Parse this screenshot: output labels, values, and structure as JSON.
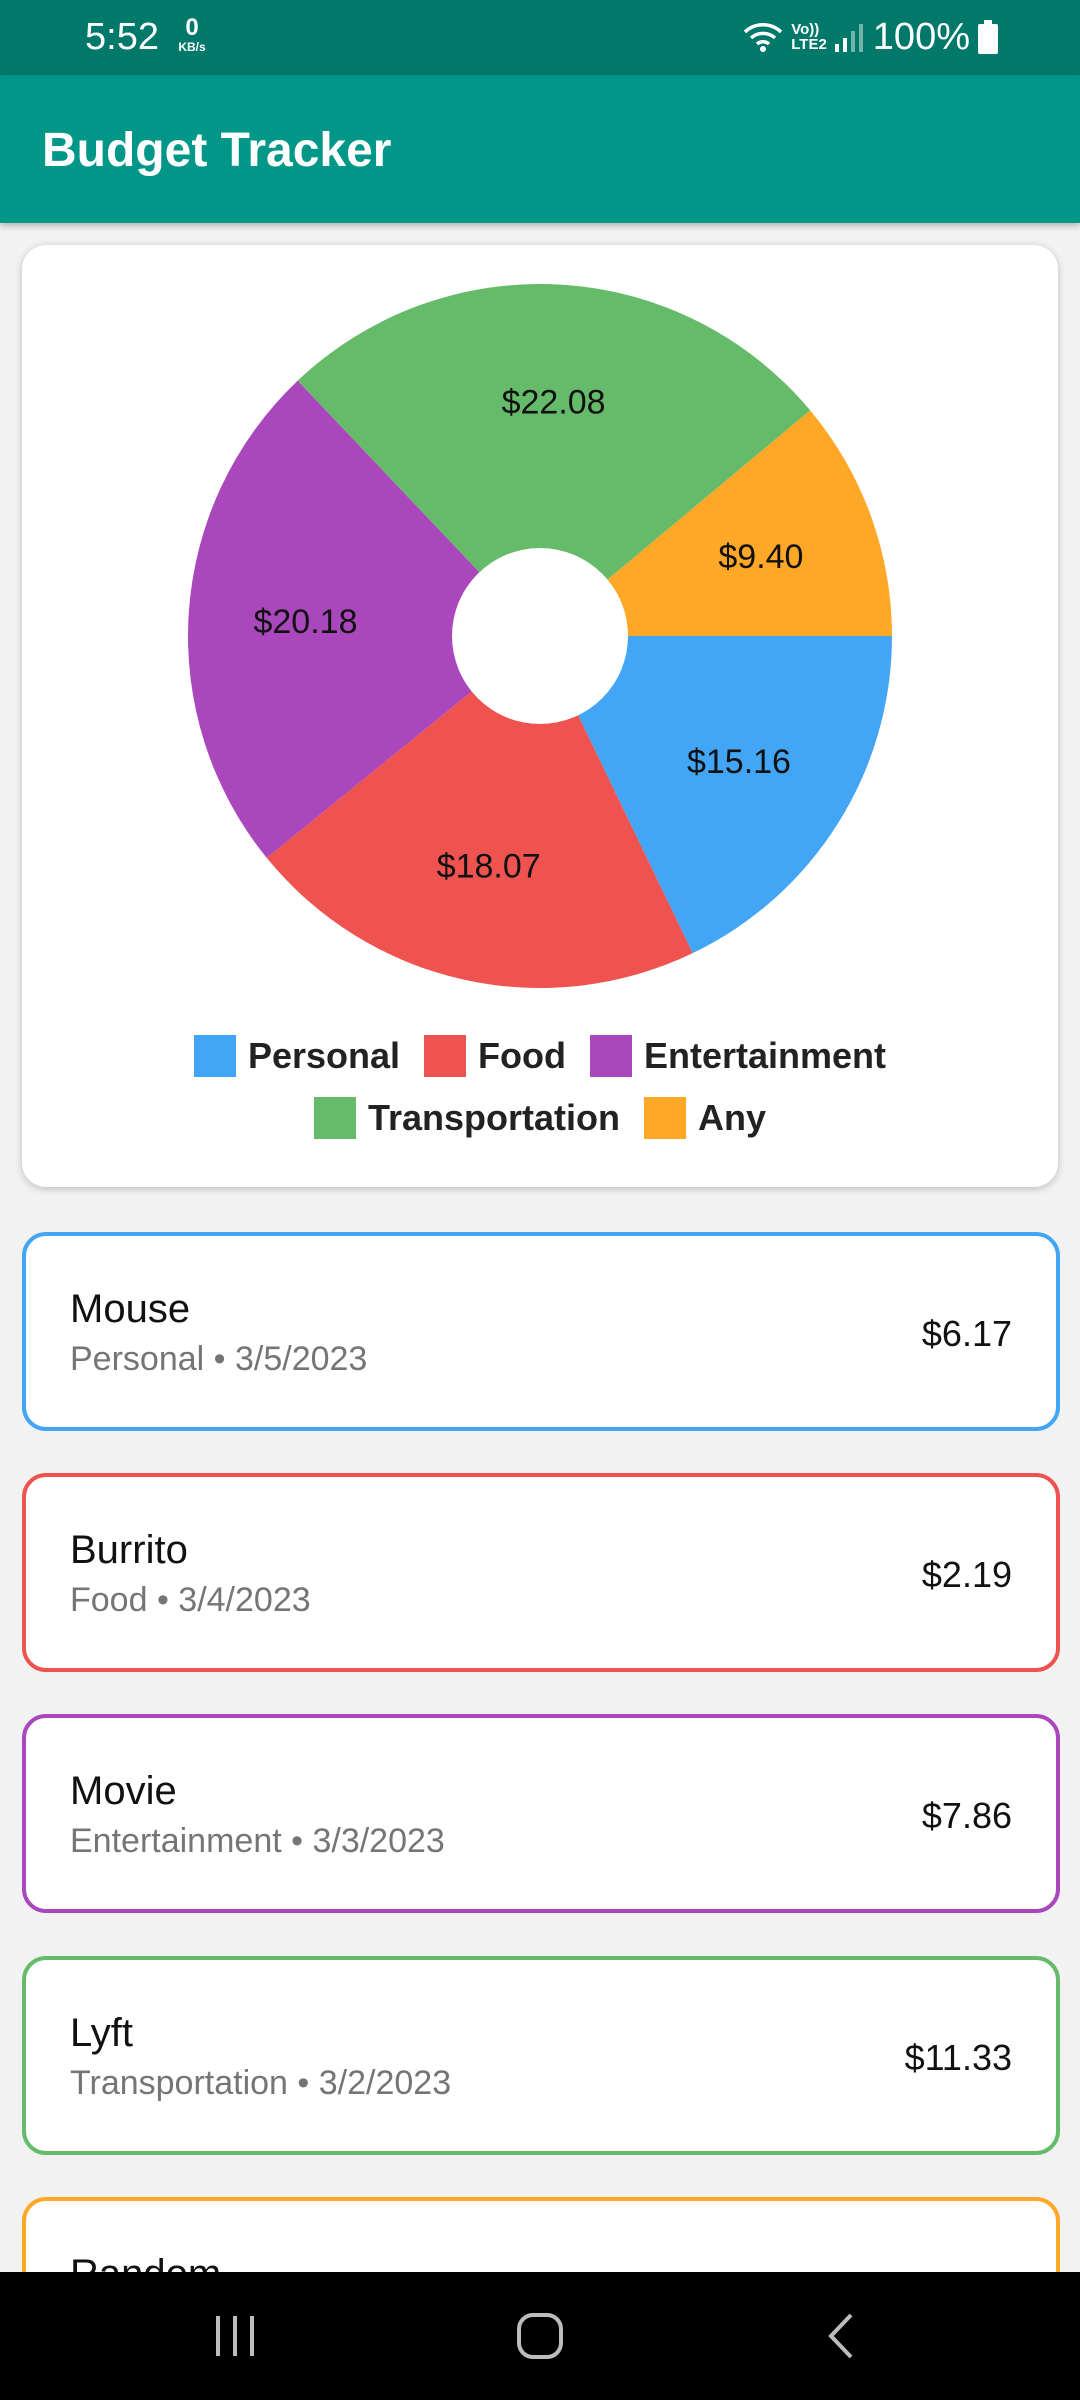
{
  "status_bar": {
    "time": "5:52",
    "net_speed_value": "0",
    "net_speed_unit": "KB/s",
    "network_label_top": "Vo))",
    "network_label_bottom": "LTE2",
    "battery_text": "100%"
  },
  "app_bar": {
    "title": "Budget Tracker"
  },
  "chart_data": {
    "type": "pie",
    "donut": true,
    "slices": [
      {
        "label": "Personal",
        "value": 15.16,
        "value_text": "$15.16",
        "color": "#42a5f5"
      },
      {
        "label": "Food",
        "value": 18.07,
        "value_text": "$18.07",
        "color": "#ef5350"
      },
      {
        "label": "Entertainment",
        "value": 20.18,
        "value_text": "$20.18",
        "color": "#ab47bc"
      },
      {
        "label": "Transportation",
        "value": 22.08,
        "value_text": "$22.08",
        "color": "#66bb6a"
      },
      {
        "label": "Any",
        "value": 9.4,
        "value_text": "$9.40",
        "color": "#ffa726"
      }
    ],
    "legend_placement": "bottom"
  },
  "expenses": [
    {
      "name": "Mouse",
      "category": "Personal",
      "date": "3/5/2023",
      "subtitle": "Personal • 3/5/2023",
      "amount": "$6.17",
      "color": "#42a5f5"
    },
    {
      "name": "Burrito",
      "category": "Food",
      "date": "3/4/2023",
      "subtitle": "Food • 3/4/2023",
      "amount": "$2.19",
      "color": "#ef5350"
    },
    {
      "name": "Movie",
      "category": "Entertainment",
      "date": "3/3/2023",
      "subtitle": "Entertainment • 3/3/2023",
      "amount": "$7.86",
      "color": "#ab47bc"
    },
    {
      "name": "Lyft",
      "category": "Transportation",
      "date": "3/2/2023",
      "subtitle": "Transportation • 3/2/2023",
      "amount": "$11.33",
      "color": "#66bb6a"
    },
    {
      "name": "Random",
      "color": "#ffa726"
    }
  ],
  "nav_bar": {
    "recents_icon": "recents-icon",
    "home_icon": "home-icon",
    "back_icon": "back-icon"
  },
  "colors": {
    "status_bar": "#00796b",
    "app_bar": "#009688",
    "background": "#f2f2f2"
  }
}
